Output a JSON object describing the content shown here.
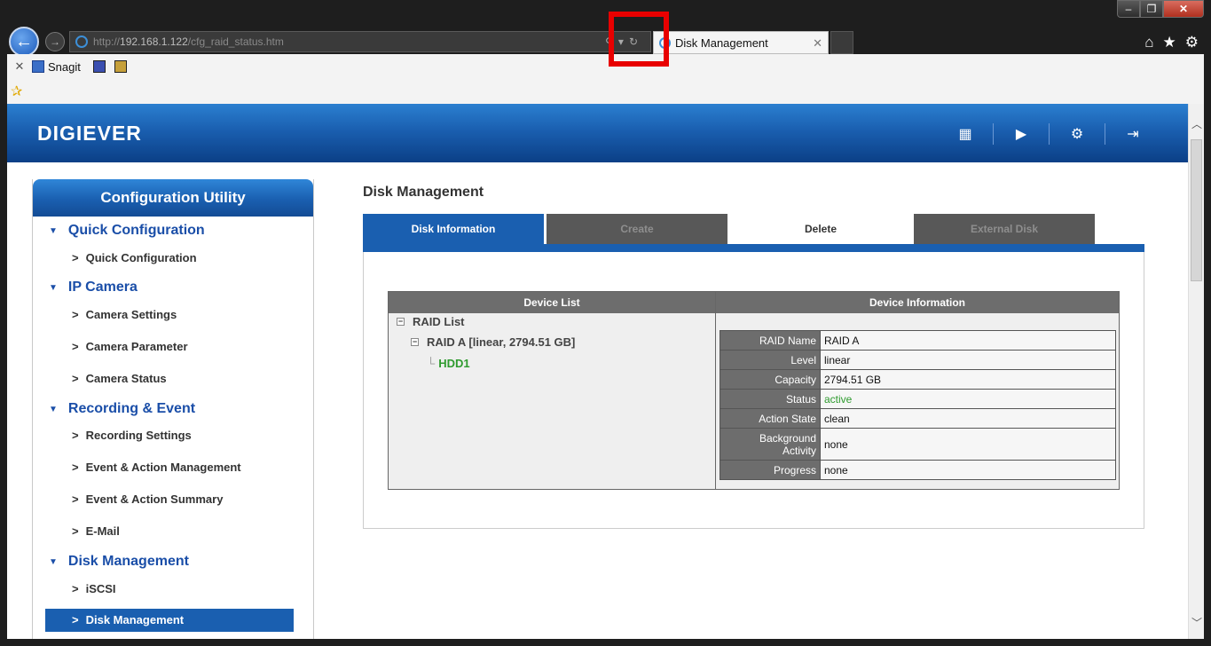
{
  "browser": {
    "url_prefix": "http://",
    "url_host": "192.168.1.122",
    "url_path": "/cfg_raid_status.htm",
    "tab_title": "Disk Management",
    "fav_snagit": "Snagit"
  },
  "header": {
    "logo": "DIGIEVER"
  },
  "sidebar": {
    "title": "Configuration Utility",
    "sections": [
      {
        "label": "Quick Configuration",
        "items": [
          "Quick Configuration"
        ]
      },
      {
        "label": "IP Camera",
        "items": [
          "Camera Settings",
          "Camera Parameter",
          "Camera Status"
        ]
      },
      {
        "label": "Recording & Event",
        "items": [
          "Recording Settings",
          "Event & Action Management",
          "Event & Action Summary",
          "E-Mail"
        ]
      },
      {
        "label": "Disk Management",
        "items": [
          "iSCSI",
          "Disk Management"
        ]
      }
    ],
    "active_item": "Disk Management"
  },
  "main": {
    "title": "Disk Management",
    "tabs": [
      {
        "label": "Disk Information",
        "state": "active"
      },
      {
        "label": "Create",
        "state": "disabled"
      },
      {
        "label": "Delete",
        "state": "normal"
      },
      {
        "label": "External Disk",
        "state": "disabled"
      }
    ],
    "device_list_header": "Device List",
    "device_info_header": "Device Information",
    "tree": {
      "root": "RAID List",
      "raid": "RAID A [linear, 2794.51 GB]",
      "disk": "HDD1"
    },
    "info": [
      {
        "key": "RAID Name",
        "value": "RAID A"
      },
      {
        "key": "Level",
        "value": "linear"
      },
      {
        "key": "Capacity",
        "value": "2794.51 GB"
      },
      {
        "key": "Status",
        "value": "active"
      },
      {
        "key": "Action State",
        "value": "clean"
      },
      {
        "key": "Background Activity",
        "value": "none"
      },
      {
        "key": "Progress",
        "value": "none"
      }
    ]
  },
  "colors": {
    "brand_blue": "#1a5fb0",
    "status_green": "#2f9b2f",
    "highlight_red": "#e80000"
  }
}
